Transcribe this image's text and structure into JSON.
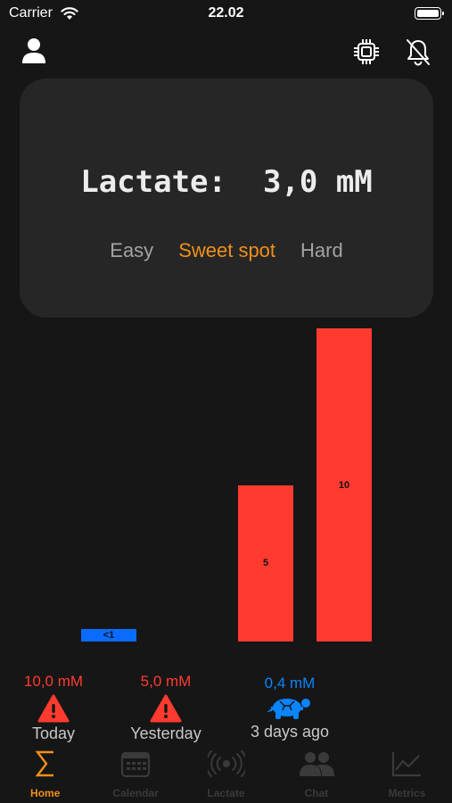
{
  "status_bar": {
    "carrier": "Carrier",
    "time": "22.02"
  },
  "toolbar": {
    "user_icon": "person-icon",
    "chip_icon": "cpu-chip-icon",
    "bell_icon": "bell-slash-icon"
  },
  "card": {
    "lactate_label": "Lactate:",
    "lactate_value": "3,0 mM",
    "zones": {
      "easy": "Easy",
      "sweet": "Sweet spot",
      "hard": "Hard"
    }
  },
  "chart_data": {
    "type": "bar",
    "categories": [
      "3 days ago",
      "Yesterday",
      "Today"
    ],
    "values": [
      0.4,
      5,
      10
    ],
    "bar_labels": [
      "<1",
      "5",
      "10"
    ],
    "colors": [
      "#0a6cff",
      "#ff3b30",
      "#ff3b30"
    ]
  },
  "stats": [
    {
      "value": "10,0 mM",
      "day": "Today",
      "icon": "warning-icon",
      "color": "#ff3b30"
    },
    {
      "value": "5,0 mM",
      "day": "Yesterday",
      "icon": "warning-icon",
      "color": "#ff3b30"
    },
    {
      "value": "0,4 mM",
      "day": "3 days ago",
      "icon": "turtle-icon",
      "color": "#0a84ff"
    }
  ],
  "tabs": [
    {
      "label": "Home",
      "icon": "sigma-icon",
      "active": true
    },
    {
      "label": "Calendar",
      "icon": "calendar-icon",
      "active": false
    },
    {
      "label": "Lactate",
      "icon": "broadcast-icon",
      "active": false
    },
    {
      "label": "Chat",
      "icon": "people-icon",
      "active": false
    },
    {
      "label": "Metrics",
      "icon": "chart-line-icon",
      "active": false
    }
  ],
  "colors": {
    "accent": "#f0901b",
    "alert": "#ff3b30",
    "low": "#0a84ff",
    "card": "#262626",
    "background": "#161616"
  }
}
